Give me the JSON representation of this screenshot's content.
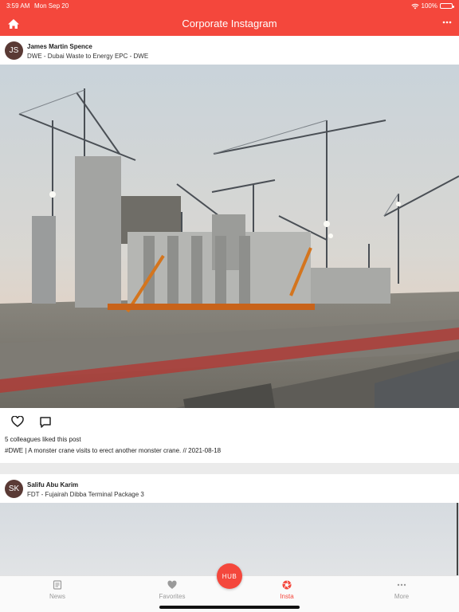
{
  "status": {
    "time": "3:59 AM",
    "date": "Mon Sep 20",
    "battery": "100%"
  },
  "nav": {
    "title": "Corporate Instagram",
    "home_icon": "home-icon",
    "more_icon": "more-dots-icon"
  },
  "posts": [
    {
      "initials": "JS",
      "author": "James Martin Spence",
      "project": "DWE - Dubai Waste to Energy EPC - DWE",
      "likes": "5 colleagues liked this post",
      "caption": "#DWE | A monster crane visits to erect another monster crane. // 2021-08-18"
    },
    {
      "initials": "SK",
      "author": "Salifu Abu Karim",
      "project": "FDT - Fujairah Dibba Terminal Package 3"
    }
  ],
  "tabs": [
    {
      "label": "News",
      "icon": "news-icon"
    },
    {
      "label": "Favorites",
      "icon": "heart-icon"
    },
    {
      "label": "Insta",
      "icon": "camera-aperture-icon"
    },
    {
      "label": "More",
      "icon": "more-dots-icon"
    }
  ],
  "hub": "HUB",
  "colors": {
    "brand": "#f4473c",
    "tab_inactive": "#9a9a9a",
    "avatar": "#5a3a35"
  }
}
